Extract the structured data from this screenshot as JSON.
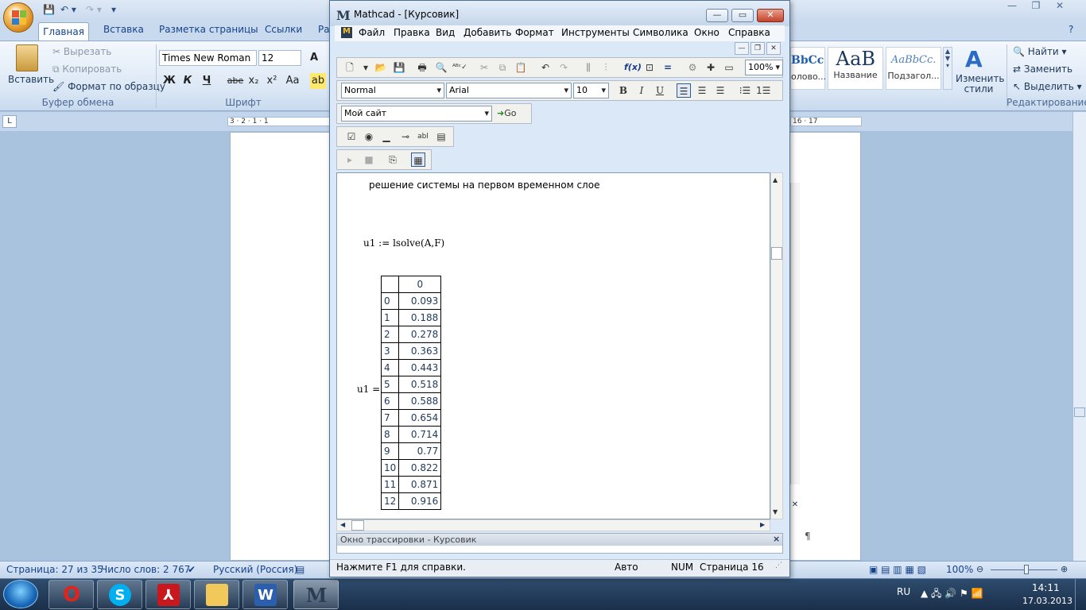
{
  "word": {
    "qat": {
      "save_icon": "save-icon",
      "undo_icon": "undo-icon",
      "redo_icon": "redo-icon"
    },
    "tabs": [
      "Главная",
      "Вставка",
      "Разметка страницы",
      "Ссылки",
      "Ра"
    ],
    "clipboard": {
      "paste": "Вставить",
      "cut": "Вырезать",
      "copy": "Копировать",
      "format_painter": "Формат по образцу",
      "group": "Буфер обмена"
    },
    "font": {
      "name": "Times New Roman",
      "size": "12",
      "bold": "Ж",
      "italic": "К",
      "underline": "Ч",
      "strike": "abe",
      "sub": "x₂",
      "sup": "x²",
      "case": "Aa",
      "group": "Шрифт"
    },
    "styles": {
      "tile1": "ВbCc",
      "tile1_label": "оловo...",
      "tile2": "АаВ",
      "tile2_label": "Название",
      "tile3": "АаВbCc.",
      "tile3_label": "Подзагол...",
      "change": "Изменить стили"
    },
    "editing": {
      "find": "Найти",
      "replace": "Заменить",
      "select": "Выделить",
      "group": "Редактирование"
    },
    "ruler": {
      "left_marks": "3 · 2 · 1 · 1",
      "right_marks": "16 · 17"
    },
    "status": {
      "page": "Страница: 27 из 35",
      "words": "Число слов: 2 767",
      "lang": "Русский (Россия)",
      "zoom": "100%"
    },
    "pilcrow": "¶"
  },
  "mathcad": {
    "title": "Mathcad - [Курсовик]",
    "menu": [
      "Файл",
      "Правка",
      "Вид",
      "Добавить",
      "Формат",
      "Инструменты",
      "Символика",
      "Окно",
      "Справка"
    ],
    "zoom": "100%",
    "style": "Normal",
    "font": "Arial",
    "font_size": "10",
    "bold": "B",
    "italic": "I",
    "underline": "U",
    "site": "Мой сайт",
    "go": "Go",
    "doc": {
      "heading": "решение системы на первом временном слое",
      "assign": "u1 := lsolve(A,F)",
      "result_label": "u1 =",
      "table_header": "0",
      "rows": [
        {
          "i": "0",
          "v": "0.093"
        },
        {
          "i": "1",
          "v": "0.188"
        },
        {
          "i": "2",
          "v": "0.278"
        },
        {
          "i": "3",
          "v": "0.363"
        },
        {
          "i": "4",
          "v": "0.443"
        },
        {
          "i": "5",
          "v": "0.518"
        },
        {
          "i": "6",
          "v": "0.588"
        },
        {
          "i": "7",
          "v": "0.654"
        },
        {
          "i": "8",
          "v": "0.714"
        },
        {
          "i": "9",
          "v": "0.77"
        },
        {
          "i": "10",
          "v": "0.822"
        },
        {
          "i": "11",
          "v": "0.871"
        },
        {
          "i": "12",
          "v": "0.916"
        }
      ]
    },
    "trace_title": "Окно трассировки - Курсовик",
    "status": {
      "help": "Нажмите F1 для справки.",
      "auto": "Авто",
      "num": "NUM",
      "page": "Страница 16"
    }
  },
  "taskbar": {
    "apps": [
      "opera",
      "skype",
      "acrobat",
      "explorer",
      "word",
      "mathcad"
    ],
    "lang": "RU",
    "time": "14:11",
    "date": "17.03.2013"
  }
}
